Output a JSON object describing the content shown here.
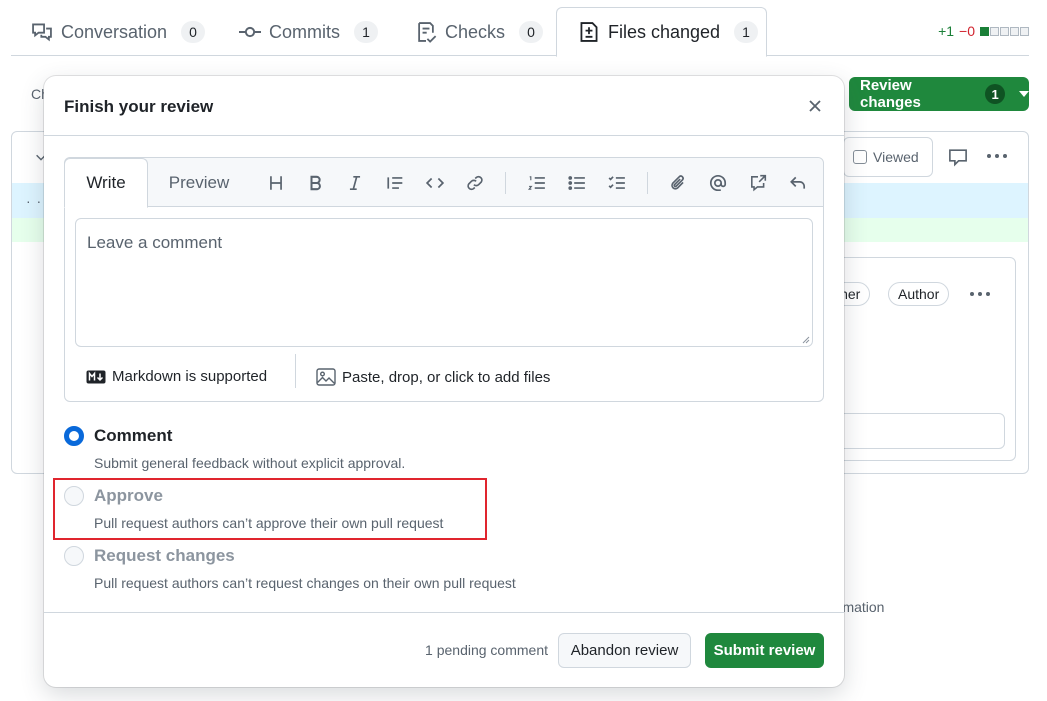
{
  "tabs": [
    {
      "label": "Conversation",
      "count": "0",
      "icon": "comment-discussion-icon"
    },
    {
      "label": "Commits",
      "count": "1",
      "icon": "commit-icon"
    },
    {
      "label": "Checks",
      "count": "0",
      "icon": "checklist-icon"
    },
    {
      "label": "Files changed",
      "count": "1",
      "icon": "file-diff-icon"
    }
  ],
  "diffstat": {
    "additions": "+1",
    "deletions": "−0"
  },
  "background": {
    "left_fragment": "Ch",
    "dots_fragment": "· ·",
    "viewed_label": "Viewed",
    "owner_pill": "wner",
    "author_pill": "Author",
    "info_fragment": "ormation"
  },
  "review_button": {
    "label": "Review changes",
    "count": "1"
  },
  "dialog": {
    "title": "Finish your review",
    "editor": {
      "write_tab": "Write",
      "preview_tab": "Preview",
      "placeholder": "Leave a comment",
      "markdown_note": "Markdown is supported",
      "attach_note": "Paste, drop, or click to add files"
    },
    "options": [
      {
        "label": "Comment",
        "description": "Submit general feedback without explicit approval."
      },
      {
        "label": "Approve",
        "description": "Pull request authors can’t approve their own pull request"
      },
      {
        "label": "Request changes",
        "description": "Pull request authors can’t request changes on their own pull request"
      }
    ],
    "pending": "1 pending comment",
    "abandon_label": "Abandon review",
    "submit_label": "Submit review"
  },
  "colors": {
    "accent": "#0969da",
    "primary_button": "#1f883d",
    "highlight": "#e0252e"
  }
}
